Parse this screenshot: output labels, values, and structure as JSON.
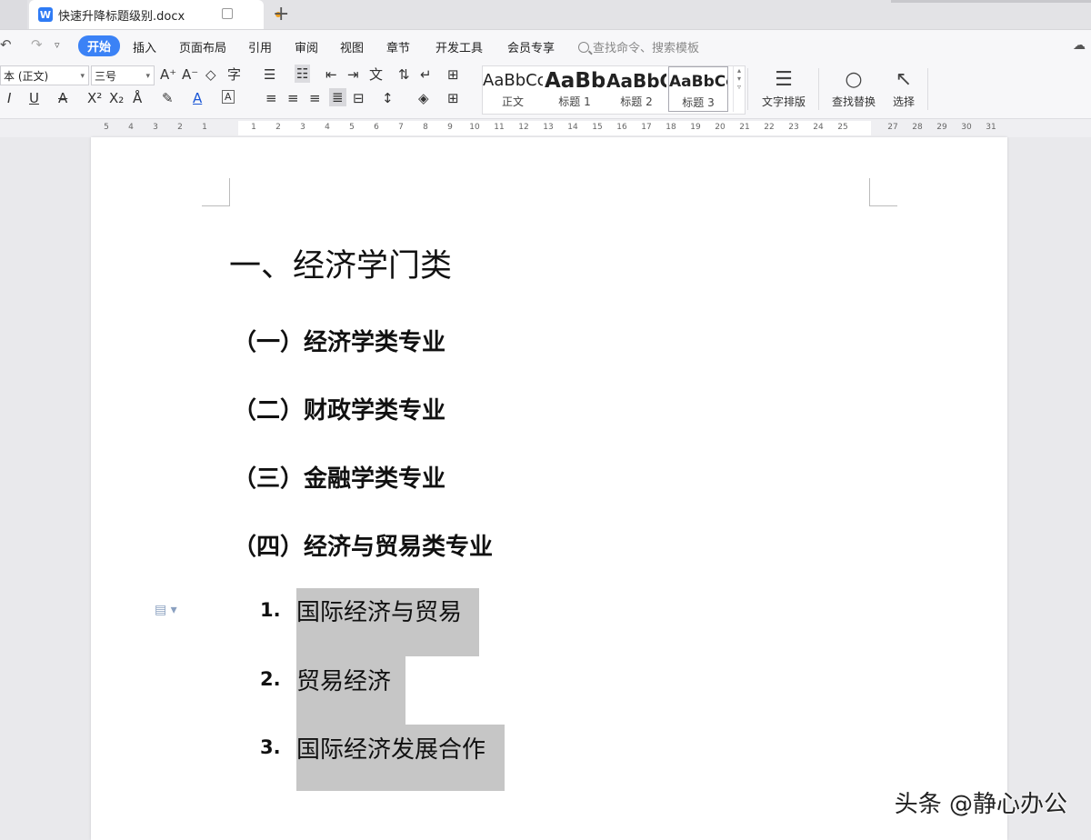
{
  "tab": {
    "title": "快速升降标题级别.docx",
    "add_symbol": "+"
  },
  "menu": {
    "items": [
      "开始",
      "插入",
      "页面布局",
      "引用",
      "审阅",
      "视图",
      "章节",
      "开发工具",
      "会员专享"
    ],
    "active_index": 0,
    "search_placeholder": "查找命令、搜索模板"
  },
  "ribbon": {
    "font_name": "本 (正文)",
    "font_size": "三号",
    "styles": [
      {
        "sample": "AaBbCcI",
        "name": "正文"
      },
      {
        "sample": "AaBb",
        "name": "标题 1"
      },
      {
        "sample": "AaBbC",
        "name": "标题 2"
      },
      {
        "sample": "AaBbCc",
        "name": "标题 3"
      }
    ],
    "selected_style": 3,
    "text_layout_label": "文字排版",
    "find_replace_label": "查找替换",
    "select_label": "选择"
  },
  "ruler": {
    "ticks": [
      "5",
      "4",
      "3",
      "2",
      "1",
      "1",
      "2",
      "3",
      "4",
      "5",
      "6",
      "7",
      "8",
      "9",
      "10",
      "11",
      "12",
      "13",
      "14",
      "15",
      "16",
      "17",
      "18",
      "19",
      "20",
      "21",
      "22",
      "23",
      "24",
      "25",
      "27",
      "28",
      "29",
      "30",
      "31"
    ]
  },
  "document": {
    "heading1": "一、经济学门类",
    "headings2": [
      "（一）经济学类专业",
      "（二）财政学类专业",
      "（三）金融学类专业",
      "（四）经济与贸易类专业"
    ],
    "list": [
      {
        "num": "1.",
        "text": "国际经济与贸易"
      },
      {
        "num": "2.",
        "text": "贸易经济"
      },
      {
        "num": "3.",
        "text": "国际经济发展合作"
      }
    ]
  },
  "watermark": "头条 @静心办公"
}
